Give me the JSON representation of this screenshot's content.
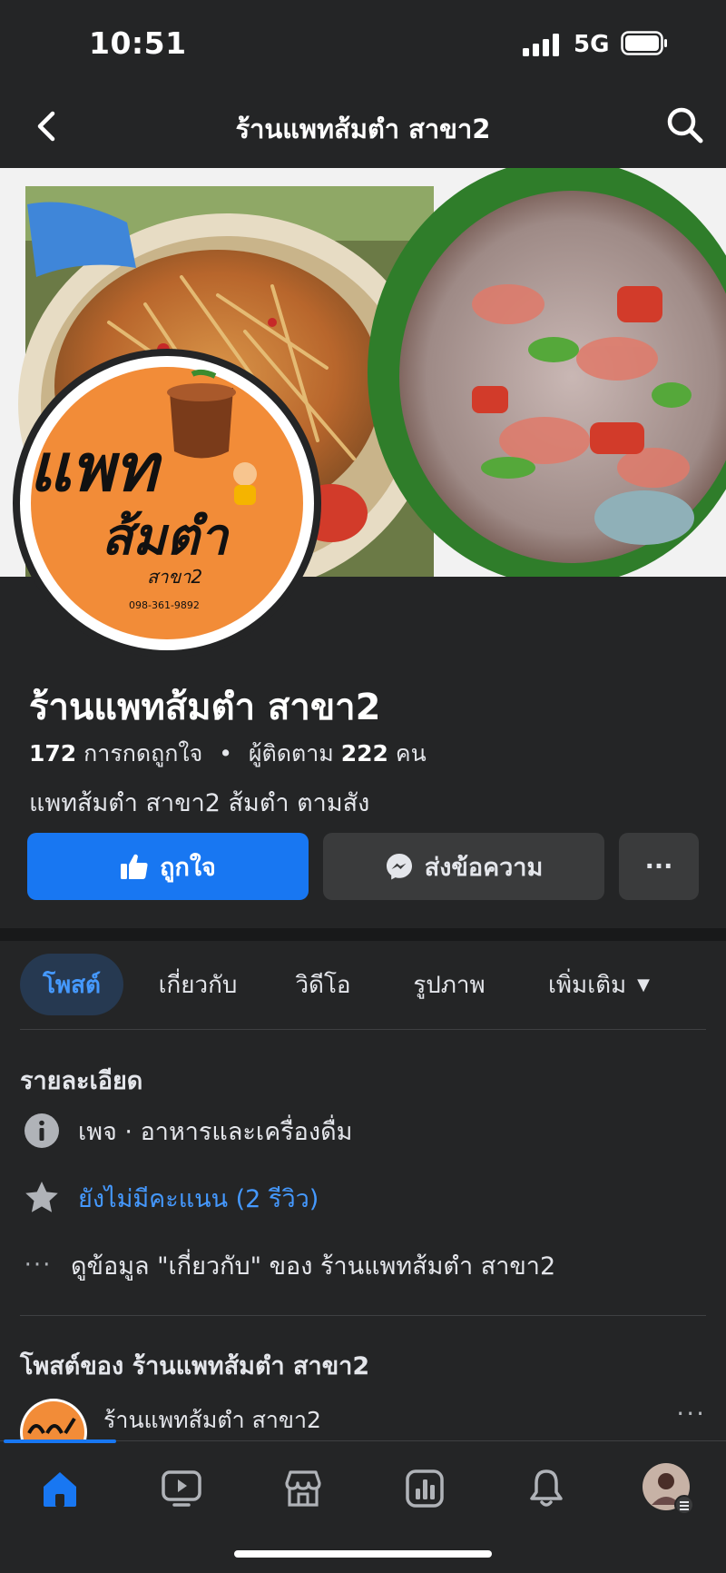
{
  "status_bar": {
    "time": "10:51",
    "network": "5G"
  },
  "top_nav": {
    "title": "ร้านแพทส้มตำ สาขา2"
  },
  "logo": {
    "line1": "แพท",
    "line2": "ส้มตำ",
    "line3": "สาขา2",
    "phone": "098-361-9892"
  },
  "profile": {
    "name": "ร้านแพทส้มตำ สาขา2",
    "likes_count": "172",
    "likes_label": "การกดถูกใจ",
    "separator": "•",
    "followers_label": "ผู้ติดตาม",
    "followers_count": "222",
    "followers_unit": "คน",
    "description": "แพทส้มตำ สาขา2 ส้มตำ ตามสัง"
  },
  "actions": {
    "like_label": "ถูกใจ",
    "message_label": "ส่งข้อความ",
    "more_label": "···"
  },
  "tabs": [
    {
      "label": "โพสต์"
    },
    {
      "label": "เกี่ยวกับ"
    },
    {
      "label": "วิดีโอ"
    },
    {
      "label": "รูปภาพ"
    },
    {
      "label": "เพิ่มเติม"
    }
  ],
  "details": {
    "title": "รายละเอียด",
    "category": "เพจ · อาหารและเครื่องดื่ม",
    "rating": "ยังไม่มีคะแนน (2 รีวิว)",
    "about_link": "ดูข้อมูล \"เกี่ยวกับ\" ของ ร้านแพทส้มตำ สาขา2"
  },
  "posts": {
    "title": "โพสต์ของ ร้านแพทส้มตำ สาขา2",
    "first_author": "ร้านแพทส้มตำ สาขา2",
    "more": "···"
  },
  "colors": {
    "accent": "#1877f2",
    "link": "#4599ff",
    "background": "#242526",
    "logo_orange": "#f28c38"
  }
}
